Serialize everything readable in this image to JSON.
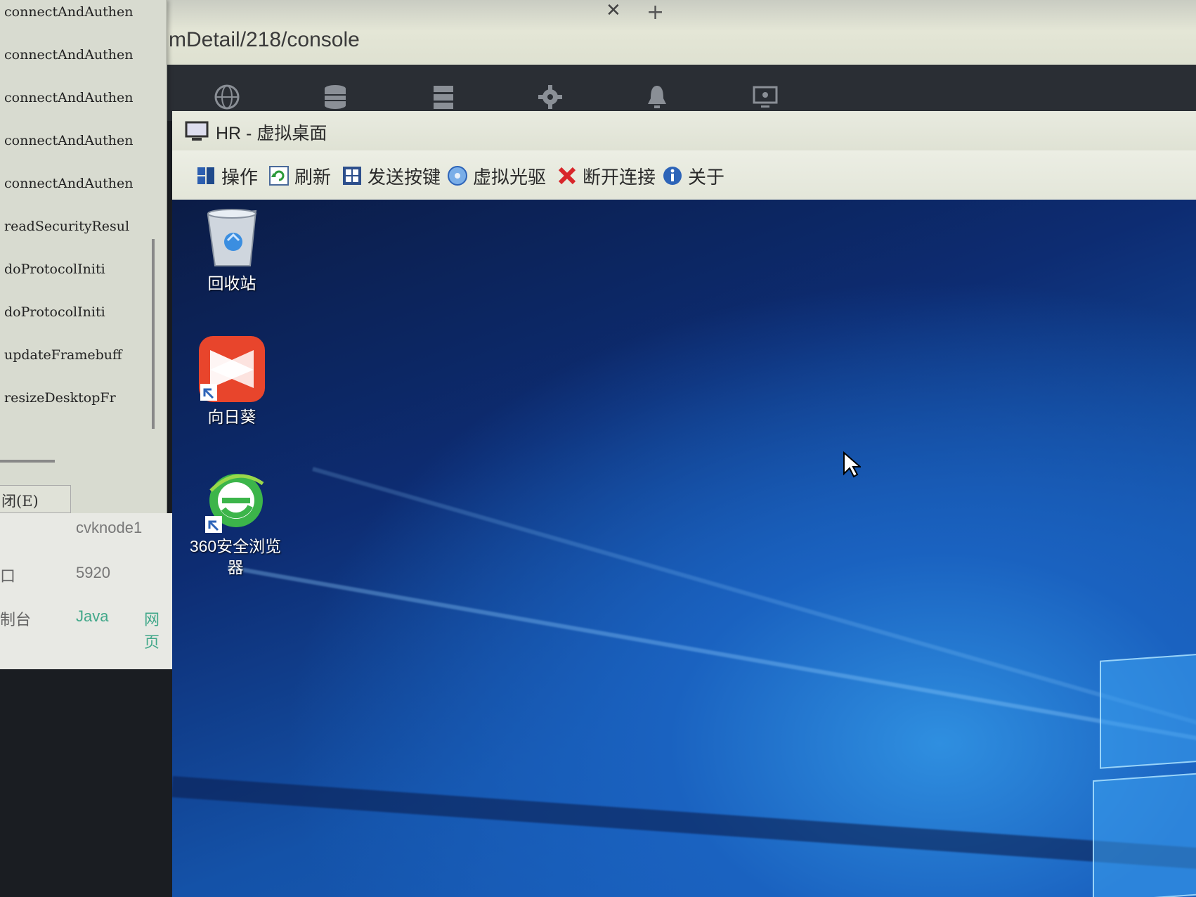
{
  "browser": {
    "url_fragment": "mDetail/218/console",
    "tab_close_glyph": "✕",
    "tab_new_glyph": "+"
  },
  "top_icons": [
    "globe-icon",
    "database-icon",
    "server-icon",
    "gear-icon",
    "bell-icon",
    "monitor-settings-icon"
  ],
  "log_window": {
    "lines": [
      "connectAndAuthen",
      "connectAndAuthen",
      "connectAndAuthen",
      "connectAndAuthen",
      "connectAndAuthen",
      "readSecurityResul",
      "doProtocolIniti",
      "doProtocolIniti",
      "updateFramebuff",
      "resizeDesktopFr"
    ],
    "close_button": "闭(E)"
  },
  "info_panel": {
    "host": "cvknode1",
    "port_label": "口",
    "port": "5920",
    "console_label": "制台",
    "java_link": "Java",
    "web_link": "网页"
  },
  "remote_desktop": {
    "title": "HR - 虚拟桌面",
    "toolbar": {
      "operate": "操作",
      "refresh": "刷新",
      "send_keys": "发送按键",
      "virtual_cdrom": "虚拟光驱",
      "disconnect": "断开连接",
      "about": "关于"
    },
    "desktop_icons": [
      {
        "label": "回收站",
        "icon": "recycle-bin-icon"
      },
      {
        "label": "向日葵",
        "icon": "sunlogin-icon"
      },
      {
        "label": "360安全浏览器",
        "icon": "360-browser-icon"
      }
    ]
  },
  "colors": {
    "desktop_blue": "#1a4f9e",
    "sunlogin_red": "#e8452c",
    "browser_green": "#3cb54a",
    "disconnect_red": "#d8262a",
    "about_blue": "#2d64b8"
  }
}
